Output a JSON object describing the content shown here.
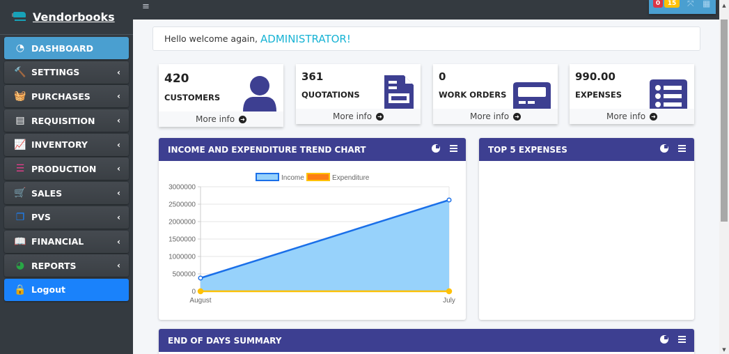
{
  "brand": {
    "name": "Vendorbooks"
  },
  "sidebar": {
    "items": [
      {
        "label": "DASHBOARD",
        "icon": "tachometer-icon",
        "icon_color": "#ffffff",
        "glyph": "◔",
        "active": true,
        "has_chevron": false
      },
      {
        "label": "SETTINGS",
        "icon": "hammer-icon",
        "icon_color": "#1a82fb",
        "glyph": "🔨",
        "has_chevron": true
      },
      {
        "label": "PURCHASES",
        "icon": "basket-icon",
        "icon_color": "#1a82fb",
        "glyph": "🧺",
        "has_chevron": true
      },
      {
        "label": "REQUISITION",
        "icon": "receipt-icon",
        "icon_color": "#ffffff",
        "glyph": "▤",
        "has_chevron": true
      },
      {
        "label": "INVENTORY",
        "icon": "chart-line-icon",
        "icon_color": "#1a82fb",
        "glyph": "📈",
        "has_chevron": true
      },
      {
        "label": "PRODUCTION",
        "icon": "tasks-icon",
        "icon_color": "#e83e8c",
        "glyph": "☰",
        "has_chevron": true
      },
      {
        "label": "SALES",
        "icon": "cart-icon",
        "icon_color": "#1a82fb",
        "glyph": "🛒",
        "has_chevron": true
      },
      {
        "label": "PVS",
        "icon": "copy-icon",
        "icon_color": "#1a82fb",
        "glyph": "❐",
        "has_chevron": true
      },
      {
        "label": "FINANCIAL",
        "icon": "book-icon",
        "icon_color": "#1a82fb",
        "glyph": "📖",
        "has_chevron": true
      },
      {
        "label": "REPORTS",
        "icon": "pie-chart-icon",
        "icon_color": "#28a745",
        "glyph": "◕",
        "has_chevron": true
      }
    ],
    "logout": {
      "label": "Logout",
      "icon": "lock-icon"
    },
    "chevron_glyph": "‹"
  },
  "topbar": {
    "menu_glyph": "≡",
    "badges": [
      {
        "value": "0",
        "color": "#dc3545"
      },
      {
        "value": "15",
        "color": "#ffc107"
      }
    ],
    "expand_glyph": "⤧",
    "grid_glyph": "▦"
  },
  "welcome": {
    "text": "Hello welcome again,",
    "user": "ADMINISTRATOR!"
  },
  "cards": [
    {
      "value": "420",
      "label": "CUSTOMERS",
      "more": "More info",
      "icon": "user-icon"
    },
    {
      "value": "361",
      "label": "QUOTATIONS",
      "more": "More info",
      "icon": "file-invoice-icon"
    },
    {
      "value": "0",
      "label": "WORK ORDERS",
      "more": "More info",
      "icon": "pager-icon"
    },
    {
      "value": "990.00",
      "label": "EXPENSES",
      "more": "More info",
      "icon": "list-icon"
    }
  ],
  "panels": {
    "trend": {
      "title": "INCOME AND EXPENDITURE TREND CHART"
    },
    "top5": {
      "title": "TOP 5 EXPENSES"
    },
    "eod": {
      "title": "END OF DAYS SUMMARY"
    }
  },
  "chart_data": {
    "type": "area",
    "title": "INCOME AND EXPENDITURE TREND CHART",
    "categories": [
      "August",
      "July"
    ],
    "series": [
      {
        "name": "Income",
        "values": [
          380000,
          2620000
        ],
        "color": "#1a6fe8",
        "fill": "#97d2fb"
      },
      {
        "name": "Expenditure",
        "values": [
          0,
          0
        ],
        "color": "#ffc107",
        "fill": "#fd7e14"
      }
    ],
    "yticks": [
      "0",
      "500000",
      "1000000",
      "1500000",
      "2000000",
      "2500000",
      "3000000"
    ],
    "ylim": [
      0,
      3000000
    ],
    "xlabel": "",
    "ylabel": "",
    "grid": true,
    "legend": "top-center"
  }
}
